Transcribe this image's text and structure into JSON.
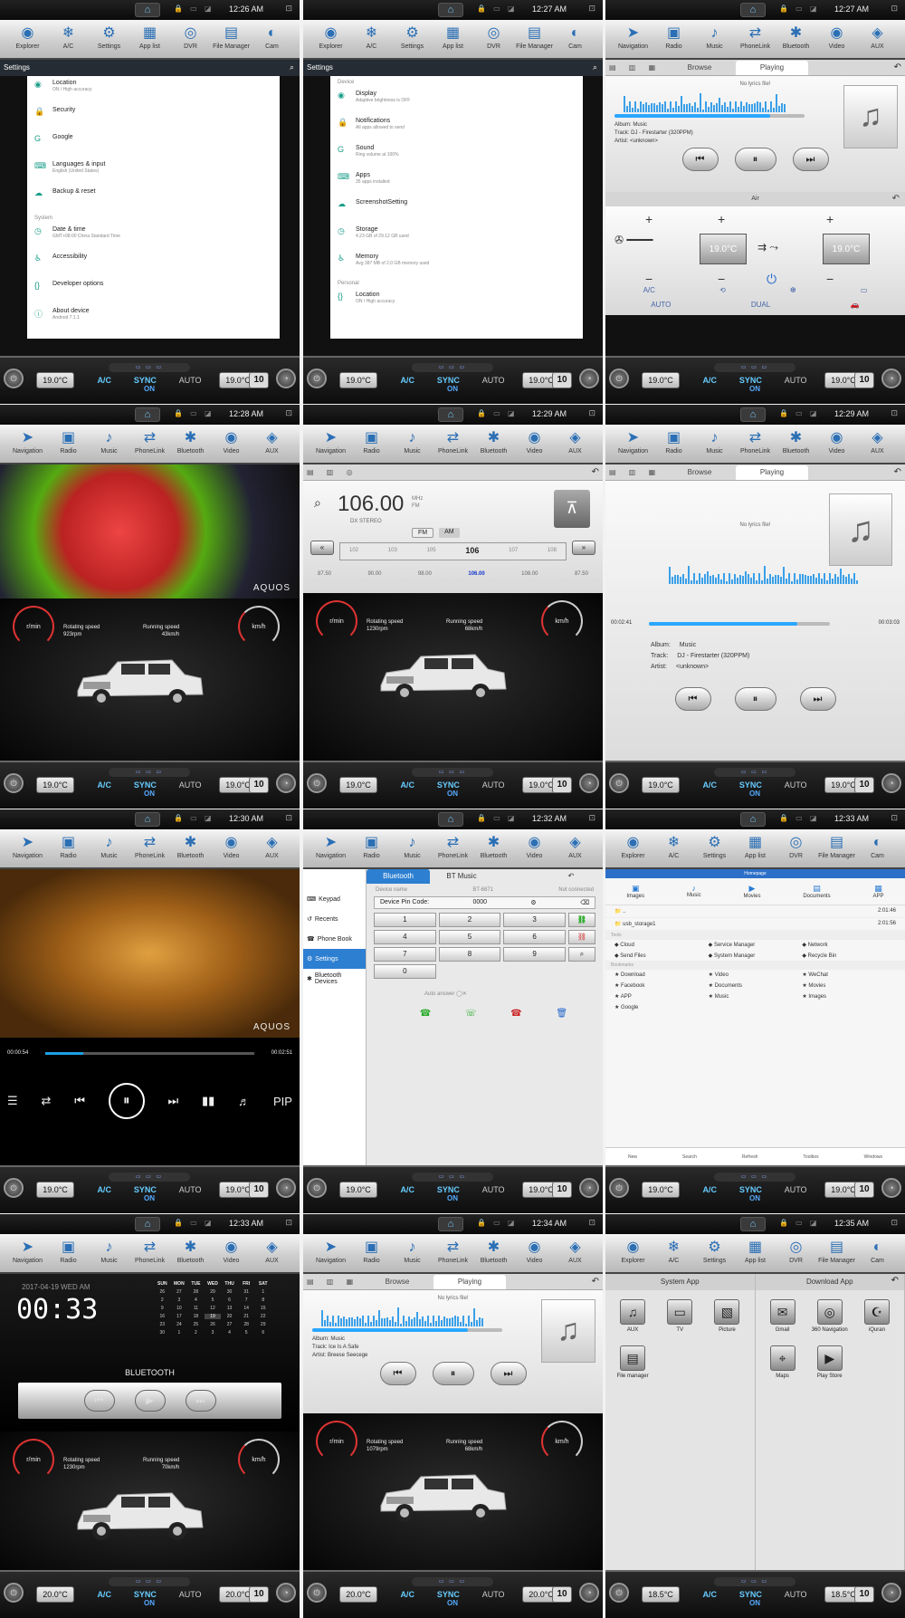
{
  "status_times": [
    "12:26 AM",
    "12:27 AM",
    "12:27 AM",
    "12:28 AM",
    "12:29 AM",
    "12:29 AM",
    "12:30 AM",
    "12:32 AM",
    "12:33 AM",
    "12:33 AM",
    "12:34 AM",
    "12:35 AM"
  ],
  "appbar_android": [
    "Explorer",
    "A/C",
    "Settings",
    "App list",
    "DVR",
    "File Manager",
    "Cam"
  ],
  "appbar_media": [
    "Navigation",
    "Radio",
    "Music",
    "PhoneLink",
    "Bluetooth",
    "Video",
    "AUX"
  ],
  "climate": {
    "rows": [
      {
        "left": "19.0°C",
        "right": "19.0°C",
        "fan": "10"
      },
      {
        "left": "19.0°C",
        "right": "19.0°C",
        "fan": "10"
      },
      {
        "left": "19.0°C",
        "right": "19.0°C",
        "fan": "10"
      },
      {
        "left": "20.0°C",
        "right": "20.0°C",
        "fan": "10"
      }
    ],
    "row3_col2": {
      "left": "18.5°C",
      "right": "18.5°C"
    },
    "ac": "A/C",
    "sync": "SYNC",
    "auto": "AUTO",
    "on": "ON"
  },
  "settings1": {
    "title": "Settings",
    "items": [
      {
        "label": "Location",
        "sub": "ON / High accuracy"
      },
      {
        "label": "Security",
        "sub": ""
      },
      {
        "label": "Google",
        "sub": ""
      },
      {
        "label": "Languages & input",
        "sub": "English (United States)"
      },
      {
        "label": "Backup & reset",
        "sub": ""
      },
      {
        "section": "System"
      },
      {
        "label": "Date & time",
        "sub": "GMT+08:00 China Standard Time"
      },
      {
        "label": "Accessibility",
        "sub": ""
      },
      {
        "label": "Developer options",
        "sub": ""
      },
      {
        "label": "About device",
        "sub": "Android 7.1.1"
      }
    ]
  },
  "settings2": {
    "title": "Settings",
    "items": [
      {
        "section": "Device"
      },
      {
        "label": "Display",
        "sub": "Adaptive brightness is OFF"
      },
      {
        "label": "Notifications",
        "sub": "All apps allowed to send"
      },
      {
        "label": "Sound",
        "sub": "Ring volume at 100%"
      },
      {
        "label": "Apps",
        "sub": "35 apps installed"
      },
      {
        "label": "ScreenshotSetting",
        "sub": ""
      },
      {
        "label": "Storage",
        "sub": "4.23 GB of 29.12 GB used"
      },
      {
        "label": "Memory",
        "sub": "Avg 387 MB of 2.0 GB memory used"
      },
      {
        "section": "Personal"
      },
      {
        "label": "Location",
        "sub": "ON / High accuracy"
      }
    ]
  },
  "music": {
    "tab_browse": "Browse",
    "tab_playing": "Playing",
    "no_lyrics": "No lyrics file!",
    "album_label": "Album:",
    "album": "Music",
    "track_label": "Track:",
    "track": "DJ - Firestarter (320PPM)",
    "artist_label": "Artist:",
    "artist": "<unknown>",
    "time_elapsed": "00:02:41",
    "time_total": "00:03:03",
    "progress": 0.82
  },
  "music_small1": {
    "line1": "Album: Music",
    "line2": "Track: DJ - Firestarter (320PPM)",
    "line3": "Artist: <unknown>"
  },
  "music_small2": {
    "line1": "Album: Music",
    "line2": "Track: Ice Is A Safe",
    "line3": "Artist: Breese Seecege"
  },
  "air": {
    "title": "Air",
    "left_temp": "19.0°C",
    "right_temp": "19.0°C",
    "ac": "A/C",
    "auto": "AUTO",
    "dual": "DUAL"
  },
  "dash": [
    {
      "rot_label": "Rotating speed",
      "rot": "923rpm",
      "run_label": "Running speed",
      "run": "43km/h"
    },
    {
      "rot_label": "Rotating speed",
      "rot": "1230rpm",
      "run_label": "Running speed",
      "run": "68km/h"
    },
    {
      "rot_label": "Rotating speed",
      "rot": "1230rpm",
      "run_label": "Running speed",
      "run": "70km/h"
    },
    {
      "rot_label": "Rotating speed",
      "rot": "1079rpm",
      "run_label": "Running speed",
      "run": "68km/h"
    }
  ],
  "gauge_unit_rpm": "r/min",
  "gauge_unit_kmh": "km/h",
  "aquos": "AQUOS",
  "radio": {
    "freq": "106.00",
    "unit": "MHz",
    "band_label": "FM",
    "stereo": "DX STEREO",
    "fm": "FM",
    "am": "AM",
    "scale": [
      "102",
      "103",
      "105",
      "106",
      "107",
      "108"
    ],
    "current": "106",
    "presets": [
      "87.50",
      "90.00",
      "98.00",
      "106.00",
      "108.00",
      "87.50"
    ],
    "selected_preset": "106.00"
  },
  "video": {
    "elapsed": "00:00:54",
    "total": "00:02:51",
    "pip": "PIP",
    "progress": 0.18
  },
  "bluetooth": {
    "tab_bt": "Bluetooth",
    "tab_music": "BT Music",
    "side": [
      "Keypad",
      "Recents",
      "Phone Book",
      "Settings",
      "Bluetooth Devices"
    ],
    "device_name_label": "Device name",
    "device_name": "BT-6871",
    "conn": "Not connected",
    "pin_label": "Device Pin Code:",
    "pin": "0000",
    "keys": [
      "1",
      "2",
      "3",
      "4",
      "5",
      "6",
      "7",
      "8",
      "9",
      "0"
    ],
    "auto_answer": "Auto answer"
  },
  "filemanager": {
    "title": "Homepage",
    "cats": [
      "Images",
      "Music",
      "Movies",
      "Documents",
      "APP"
    ],
    "rows": [
      {
        "name": "..",
        "date": "2:01:46"
      },
      {
        "name": "usb_storage1",
        "date": "2:01:56"
      }
    ],
    "sec_tools": "Tools",
    "tools": [
      "Cloud",
      "Service Manager",
      "Network",
      "Send Files",
      "System Manager",
      "Recycle Bin"
    ],
    "sec_bookmarks": "Bookmarks",
    "bookmarks": [
      "Download",
      "Video",
      "WeChat",
      "Facebook",
      "Documents",
      "Movies",
      "APP",
      "Music",
      "Images",
      "Google"
    ],
    "bottom": [
      "New",
      "Search",
      "Refresh",
      "Toolbox",
      "Windows"
    ]
  },
  "clock": {
    "date": "2017-04-19 WED AM",
    "time": "00:33",
    "cal_head": [
      "SUN",
      "MON",
      "TUE",
      "WED",
      "THU",
      "FRI",
      "SAT"
    ],
    "cal_days": [
      "26",
      "27",
      "28",
      "29",
      "30",
      "31",
      "1",
      "2",
      "3",
      "4",
      "5",
      "6",
      "7",
      "8",
      "9",
      "10",
      "11",
      "12",
      "13",
      "14",
      "15",
      "16",
      "17",
      "18",
      "19",
      "20",
      "21",
      "22",
      "23",
      "24",
      "25",
      "26",
      "27",
      "28",
      "29",
      "30",
      "1",
      "2",
      "3",
      "4",
      "5",
      "6"
    ],
    "today": "19",
    "bt_label": "BLUETOOTH"
  },
  "apps": {
    "system": "System App",
    "download": "Download App",
    "sys_items": [
      "AUX",
      "TV",
      "Picture",
      "File manager"
    ],
    "dl_items": [
      "Gmail",
      "360 Navigation",
      "iQuran",
      "Maps",
      "Play Store"
    ]
  }
}
